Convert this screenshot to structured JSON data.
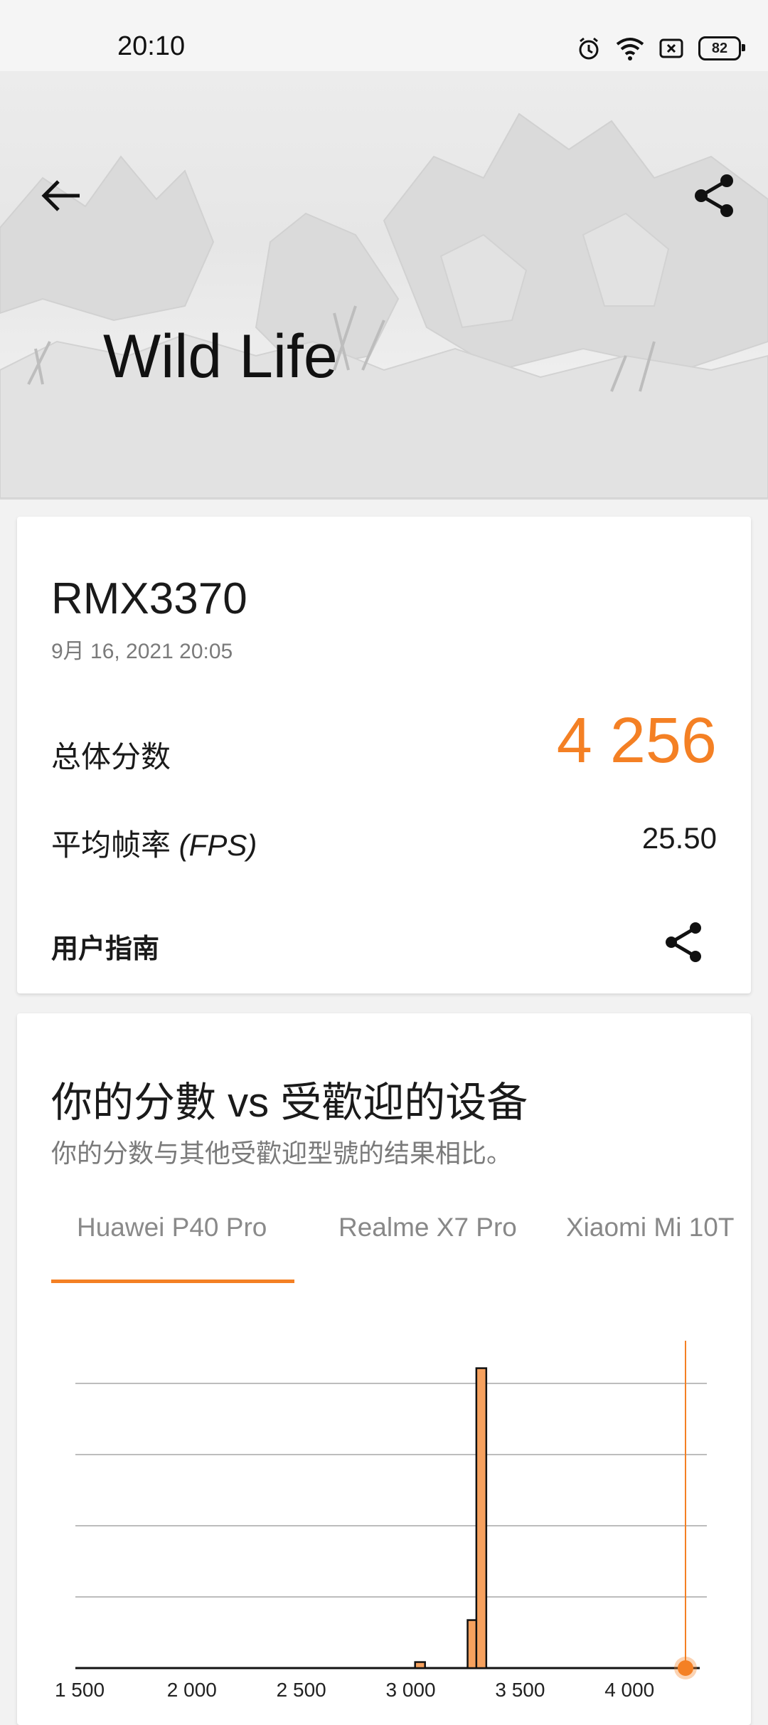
{
  "status_bar": {
    "time": "20:10",
    "battery": "82"
  },
  "hero": {
    "title": "Wild Life"
  },
  "result": {
    "device": "RMX3370",
    "date": "9月 16, 2021 20:05",
    "total_label": "总体分数",
    "total_score": "4 256",
    "fps_label_prefix": "平均帧率 ",
    "fps_label_unit": "(FPS)",
    "fps_value": "25.50",
    "guide_label": "用户指南"
  },
  "compare": {
    "title": "你的分數 vs 受歡迎的设备",
    "subtitle": "你的分数与其他受歡迎型號的结果相比。",
    "tabs": [
      "Huawei P40 Pro",
      "Realme X7 Pro",
      "Xiaomi Mi 10T"
    ],
    "active_tab": 0
  },
  "colors": {
    "accent": "#f48024",
    "bar_fill": "#f6a15e"
  },
  "chart_data": {
    "type": "bar",
    "x_ticks": [
      "1 500",
      "2 000",
      "2 500",
      "3 000",
      "3 500",
      "4 000"
    ],
    "xlim": [
      1500,
      4256
    ],
    "bins": [
      {
        "x": 3020,
        "value": 0.02
      },
      {
        "x": 3260,
        "value": 0.16
      },
      {
        "x": 3300,
        "value": 1.0
      }
    ],
    "your_score": 4256
  }
}
